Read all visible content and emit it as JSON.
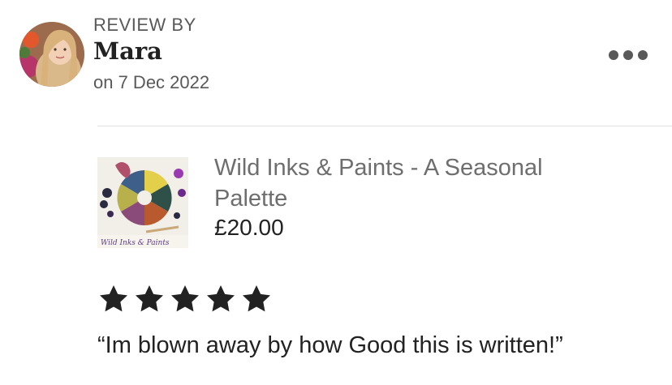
{
  "review": {
    "label": "REVIEW BY",
    "reviewer": "Mara",
    "date": "on 7 Dec 2022",
    "rating": 5,
    "text": "“Im blown away by how Good this is written!”"
  },
  "product": {
    "title": "Wild Inks & Paints - A Seasonal Palette",
    "price": "£20.00",
    "thumbnail_caption": "Wild Inks & Paints"
  },
  "icons": {
    "more": "more-options-icon",
    "star": "star-icon"
  },
  "colors": {
    "text_primary": "#222222",
    "text_secondary": "#595959",
    "product_title": "#6e6e6e",
    "divider": "#e1e1e1",
    "star": "#222222"
  }
}
